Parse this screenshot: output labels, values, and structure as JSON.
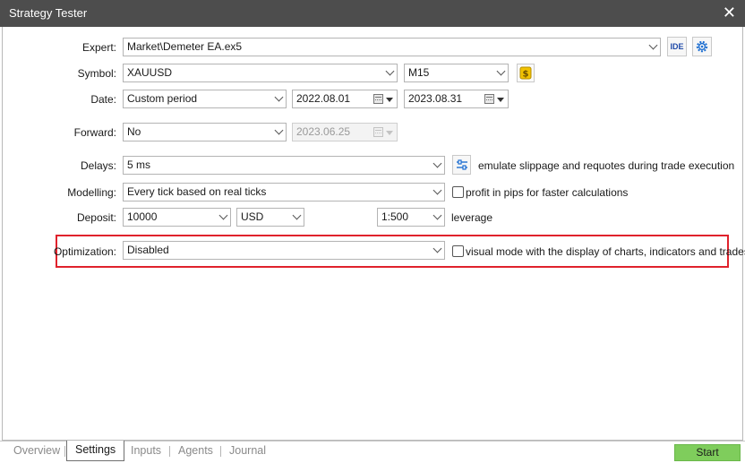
{
  "window": {
    "title": "Strategy Tester",
    "close_glyph": "✕"
  },
  "form": {
    "expert": {
      "label": "Expert:",
      "value": "Market\\Demeter EA.ex5",
      "ide_button": "IDE"
    },
    "symbol": {
      "label": "Symbol:",
      "value": "XAUUSD",
      "timeframe": "M15"
    },
    "date": {
      "label": "Date:",
      "period": "Custom period",
      "from": "2022.08.01",
      "to": "2023.08.31"
    },
    "forward": {
      "label": "Forward:",
      "value": "No",
      "date": "2023.06.25"
    },
    "delays": {
      "label": "Delays:",
      "value": "5 ms",
      "checkbox_text": "emulate slippage and requotes during trade execution"
    },
    "modelling": {
      "label": "Modelling:",
      "value": "Every tick based on real ticks",
      "checkbox_text": "profit in pips for faster calculations",
      "checked": false
    },
    "deposit": {
      "label": "Deposit:",
      "amount": "10000",
      "currency": "USD",
      "leverage": "1:500",
      "leverage_label": "leverage"
    },
    "optimization": {
      "label": "Optimization:",
      "value": "Disabled",
      "checkbox_text": "visual mode with the display of charts, indicators and trades",
      "checked": false
    }
  },
  "tabs": [
    {
      "label": "Overview",
      "active": false
    },
    {
      "label": "Settings",
      "active": true
    },
    {
      "label": "Inputs",
      "active": false
    },
    {
      "label": "Agents",
      "active": false
    },
    {
      "label": "Journal",
      "active": false
    }
  ],
  "start_button": "Start",
  "colors": {
    "titlebar": "#4d4d4d",
    "highlight": "#e0222c",
    "start": "#7fcd5c",
    "coin": "#f2c200"
  }
}
